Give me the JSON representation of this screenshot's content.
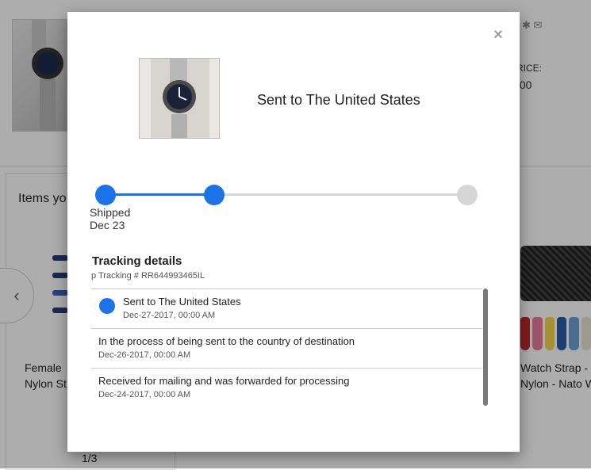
{
  "background": {
    "items_title": "Items yo",
    "left_item_caption_1": "Female",
    "left_item_caption_2": "Nylon St",
    "price_label": "RICE:",
    "price_value": ".00",
    "right_item_caption_1": "Watch Strap -",
    "right_item_caption_2": "Nylon - Nato W",
    "pagination": "1/3",
    "prev_arrow": "‹"
  },
  "modal": {
    "close_glyph": "×",
    "shipment_title": "Sent to The United States",
    "progress": {
      "steps_total": 3,
      "steps_completed": 2,
      "current_step_label": "Shipped",
      "current_step_date": "Dec 23"
    },
    "tracking": {
      "title": "Tracking details",
      "number_line": "p Tracking # RR644993465IL",
      "events": [
        {
          "description": "Sent to The United States",
          "date": "Dec-27-2017, 00:00 AM",
          "current": true
        },
        {
          "description": "In the process of being sent to the country of destination",
          "date": "Dec-26-2017, 00:00 AM",
          "current": false
        },
        {
          "description": "Received for mailing and was forwarded for processing",
          "date": "Dec-24-2017, 00:00 AM",
          "current": false
        }
      ]
    }
  },
  "colors": {
    "accent": "#1a73e8",
    "inactive": "#d6d6d6",
    "overlay": "rgba(0,0,0,0.32)"
  },
  "icons": {
    "close": "close-icon",
    "prev": "chevron-left-icon",
    "current_event": "status-dot-icon"
  }
}
